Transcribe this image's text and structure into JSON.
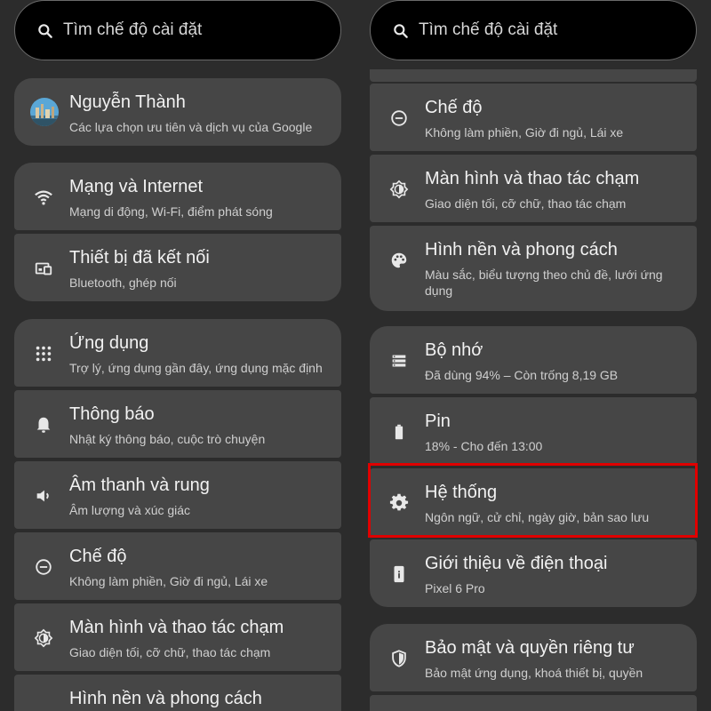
{
  "search": {
    "placeholder": "Tìm chế độ cài đặt"
  },
  "left_panel": {
    "items": [
      {
        "title": "Nguyễn Thành",
        "subtitle": "Các lựa chọn ưu tiên và dịch vụ của Google",
        "icon": "account-avatar"
      },
      {
        "title": "Mạng và Internet",
        "subtitle": "Mạng di động, Wi-Fi, điểm phát sóng",
        "icon": "wifi-icon"
      },
      {
        "title": "Thiết bị đã kết nối",
        "subtitle": "Bluetooth, ghép nối",
        "icon": "connected-devices-icon"
      },
      {
        "title": "Ứng dụng",
        "subtitle": "Trợ lý, ứng dụng gần đây, ứng dụng mặc định",
        "icon": "apps-grid-icon"
      },
      {
        "title": "Thông báo",
        "subtitle": "Nhật ký thông báo, cuộc trò chuyện",
        "icon": "bell-icon"
      },
      {
        "title": "Âm thanh và rung",
        "subtitle": "Âm lượng và xúc giác",
        "icon": "speaker-icon"
      },
      {
        "title": "Chế độ",
        "subtitle": "Không làm phiền, Giờ đi ngủ, Lái xe",
        "icon": "do-not-disturb-icon"
      },
      {
        "title": "Màn hình và thao tác chạm",
        "subtitle": "Giao diện tối, cỡ chữ, thao tác chạm",
        "icon": "brightness-icon"
      },
      {
        "title": "Hình nền và phong cách",
        "subtitle": "",
        "icon": "palette-icon"
      }
    ]
  },
  "right_panel": {
    "items": [
      {
        "title": "Chế độ",
        "subtitle": "Không làm phiền, Giờ đi ngủ, Lái xe",
        "icon": "do-not-disturb-icon"
      },
      {
        "title": "Màn hình và thao tác chạm",
        "subtitle": "Giao diện tối, cỡ chữ, thao tác chạm",
        "icon": "brightness-icon"
      },
      {
        "title": "Hình nền và phong cách",
        "subtitle": "Màu sắc, biểu tượng theo chủ đề, lưới ứng dụng",
        "icon": "palette-icon"
      },
      {
        "title": "Bộ nhớ",
        "subtitle": "Đã dùng 94% – Còn trống 8,19 GB",
        "icon": "storage-icon"
      },
      {
        "title": "Pin",
        "subtitle": "18% - Cho đến 13:00",
        "icon": "battery-icon"
      },
      {
        "title": "Hệ thống",
        "subtitle": "Ngôn ngữ, cử chỉ, ngày giờ, bản sao lưu",
        "icon": "gear-icon"
      },
      {
        "title": "Giới thiệu về điện thoại",
        "subtitle": "Pixel 6 Pro",
        "icon": "phone-info-icon"
      },
      {
        "title": "Bảo mật và quyền riêng tư",
        "subtitle": "Bảo mật ứng dụng, khoá thiết bị, quyền",
        "icon": "shield-icon"
      }
    ]
  },
  "colors": {
    "background": "#2c2c2c",
    "card": "#464646",
    "highlight": "#e00000",
    "search_bg": "#000000"
  }
}
